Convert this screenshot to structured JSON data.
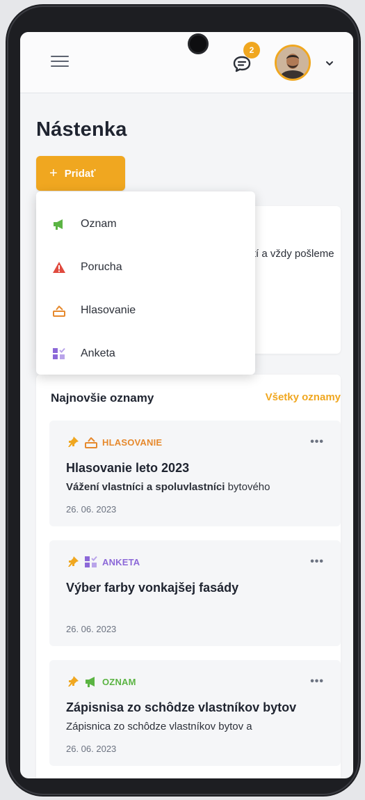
{
  "header": {
    "messages_badge": "2"
  },
  "page": {
    "title": "Nástenka",
    "add_button_label": "Pridať"
  },
  "info_card": {
    "text": "ostí a vždy pošleme"
  },
  "add_menu": {
    "items": [
      {
        "label": "Oznam",
        "icon": "megaphone-icon",
        "color": "#5bb443"
      },
      {
        "label": "Porucha",
        "icon": "warning-icon",
        "color": "#e04a3f"
      },
      {
        "label": "Hlasovanie",
        "icon": "ballot-box-icon",
        "color": "#e6892d"
      },
      {
        "label": "Anketa",
        "icon": "poll-icon",
        "color": "#8c68d8"
      }
    ]
  },
  "news": {
    "title": "Najnovšie oznamy",
    "all_link": "Všetky oznamy",
    "posts": [
      {
        "tag": "HLASOVANIE",
        "tag_color": "#e6892d",
        "title": "Hlasovanie leto 2023",
        "excerpt_bold": "Vážení vlastníci a spoluvlastníci",
        "excerpt_rest": " bytového",
        "date": "26. 06. 2023",
        "pinned": true
      },
      {
        "tag": "ANKETA",
        "tag_color": "#8c68d8",
        "title": "Výber farby vonkajšej fasády",
        "excerpt_bold": "",
        "excerpt_rest": "",
        "date": "26. 06. 2023",
        "pinned": true
      },
      {
        "tag": "OZNAM",
        "tag_color": "#5bb443",
        "title": "Zápisnisa zo schôdze vlastníkov bytov",
        "excerpt_bold": "",
        "excerpt_rest": "Zápisnica zo schôdze vlastníkov bytov a",
        "date": "26. 06. 2023",
        "pinned": true
      }
    ]
  },
  "colors": {
    "accent": "#f0a720",
    "pin": "#f0a720",
    "background": "#f4f5f7"
  }
}
